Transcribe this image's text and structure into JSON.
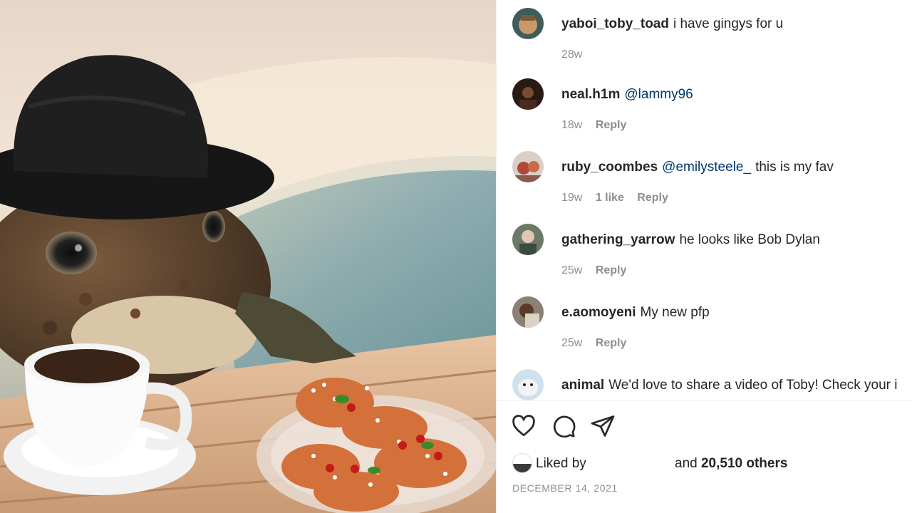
{
  "comments": [
    {
      "user": "yaboi_toby_toad",
      "mention": "",
      "text": "i have gingys for u",
      "age": "28w",
      "likes": "",
      "reply": ""
    },
    {
      "user": "neal.h1m",
      "mention": "@lammy96",
      "text": "",
      "age": "18w",
      "likes": "",
      "reply": "Reply"
    },
    {
      "user": "ruby_coombes",
      "mention": "@emilysteele_",
      "text": "this is my fav",
      "age": "19w",
      "likes": "1 like",
      "reply": "Reply"
    },
    {
      "user": "gathering_yarrow",
      "mention": "",
      "text": "he looks like Bob Dylan",
      "age": "25w",
      "likes": "",
      "reply": "Reply"
    },
    {
      "user": "e.aomoyeni",
      "mention": "",
      "text": "My new pfp",
      "age": "25w",
      "likes": "",
      "reply": "Reply"
    },
    {
      "user": "animal",
      "mention": "",
      "text": "We'd love to share a video of Toby! Check your i",
      "age": "",
      "likes": "",
      "reply": ""
    }
  ],
  "actions": {
    "like_icon": "heart-icon",
    "comment_icon": "comment-bubble-icon",
    "share_icon": "paper-plane-icon"
  },
  "likes": {
    "prefix": "Liked by",
    "suffix": "and",
    "count": "20,510 others"
  },
  "date": "DECEMBER 14, 2021",
  "colors": {
    "link": "#00376b",
    "muted": "#8e8e8e",
    "text": "#262626",
    "border": "#efefef"
  }
}
